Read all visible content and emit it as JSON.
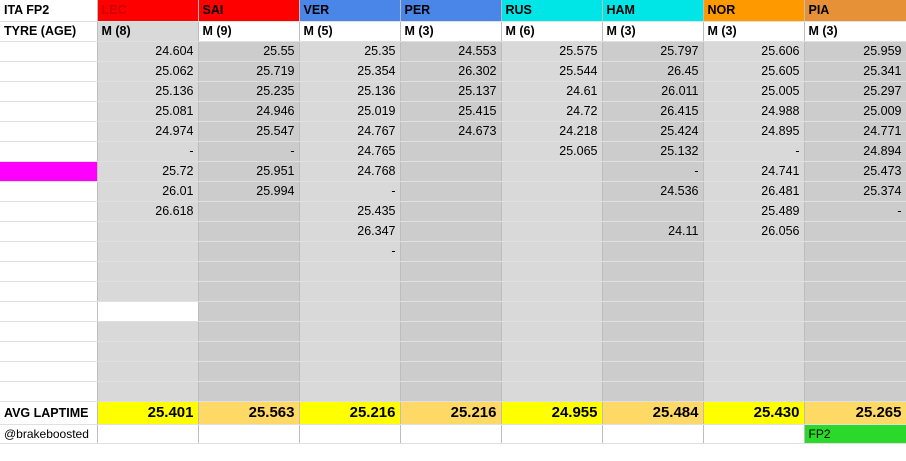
{
  "title": "ITA FP2",
  "tyre_label": "TYRE (AGE)",
  "avg_label": "AVG LAPTIME",
  "credit": "@brakeboosted",
  "session_tag": "FP2",
  "drivers": [
    {
      "code": "LEC",
      "tyre": "M (8)",
      "color": "#ff0000",
      "text_color": "#cc0000",
      "avg": "25.401"
    },
    {
      "code": "SAI",
      "tyre": "M (9)",
      "color": "#ff0000",
      "text_color": "#000000",
      "avg": "25.563"
    },
    {
      "code": "VER",
      "tyre": "M (5)",
      "color": "#4a86e8",
      "text_color": "#000000",
      "avg": "25.216"
    },
    {
      "code": "PER",
      "tyre": "M (3)",
      "color": "#4a86e8",
      "text_color": "#000000",
      "avg": "25.216"
    },
    {
      "code": "RUS",
      "tyre": "M (6)",
      "color": "#00e5e5",
      "text_color": "#000000",
      "avg": "24.955"
    },
    {
      "code": "HAM",
      "tyre": "M (3)",
      "color": "#00e5e5",
      "text_color": "#000000",
      "avg": "25.484"
    },
    {
      "code": "NOR",
      "tyre": "M (3)",
      "color": "#ff9900",
      "text_color": "#000000",
      "avg": "25.430"
    },
    {
      "code": "PIA",
      "tyre": "M (3)",
      "color": "#e69138",
      "text_color": "#000000",
      "avg": "25.265"
    }
  ],
  "laps": [
    [
      "24.604",
      "25.55",
      "25.35",
      "24.553",
      "25.575",
      "25.797",
      "25.606",
      "25.959"
    ],
    [
      "25.062",
      "25.719",
      "25.354",
      "26.302",
      "25.544",
      "26.45",
      "25.605",
      "25.341"
    ],
    [
      "25.136",
      "25.235",
      "25.136",
      "25.137",
      "24.61",
      "26.011",
      "25.005",
      "25.297"
    ],
    [
      "25.081",
      "24.946",
      "25.019",
      "25.415",
      "24.72",
      "26.415",
      "24.988",
      "25.009"
    ],
    [
      "24.974",
      "25.547",
      "24.767",
      "24.673",
      "24.218",
      "25.424",
      "24.895",
      "24.771"
    ],
    [
      "-",
      "-",
      "24.765",
      "",
      "25.065",
      "25.132",
      "-",
      "24.894"
    ],
    [
      "25.72",
      "25.951",
      "24.768",
      "",
      "",
      "-",
      "24.741",
      "25.473"
    ],
    [
      "26.01",
      "25.994",
      "-",
      "",
      "",
      "24.536",
      "26.481",
      "25.374"
    ],
    [
      "26.618",
      "",
      "25.435",
      "",
      "",
      "",
      "25.489",
      "-"
    ],
    [
      "",
      "",
      "26.347",
      "",
      "",
      "24.11",
      "26.056",
      ""
    ],
    [
      "",
      "",
      "-",
      "",
      "",
      "",
      "",
      ""
    ],
    [
      "",
      "",
      "",
      "",
      "",
      "",
      "",
      ""
    ],
    [
      "",
      "",
      "",
      "",
      "",
      "",
      "",
      ""
    ],
    [
      "",
      "",
      "",
      "",
      "",
      "",
      "",
      ""
    ],
    [
      "",
      "",
      "",
      "",
      "",
      "",
      "",
      ""
    ],
    [
      "",
      "",
      "",
      "",
      "",
      "",
      "",
      ""
    ],
    [
      "",
      "",
      "",
      "",
      "",
      "",
      "",
      ""
    ],
    [
      "",
      "",
      "",
      "",
      "",
      "",
      "",
      ""
    ]
  ],
  "colors": {
    "avg_bright": "#ffff00",
    "avg_light": "#ffd966",
    "marker": "#ff00ff",
    "fp2_tag": "#2bd92b"
  }
}
